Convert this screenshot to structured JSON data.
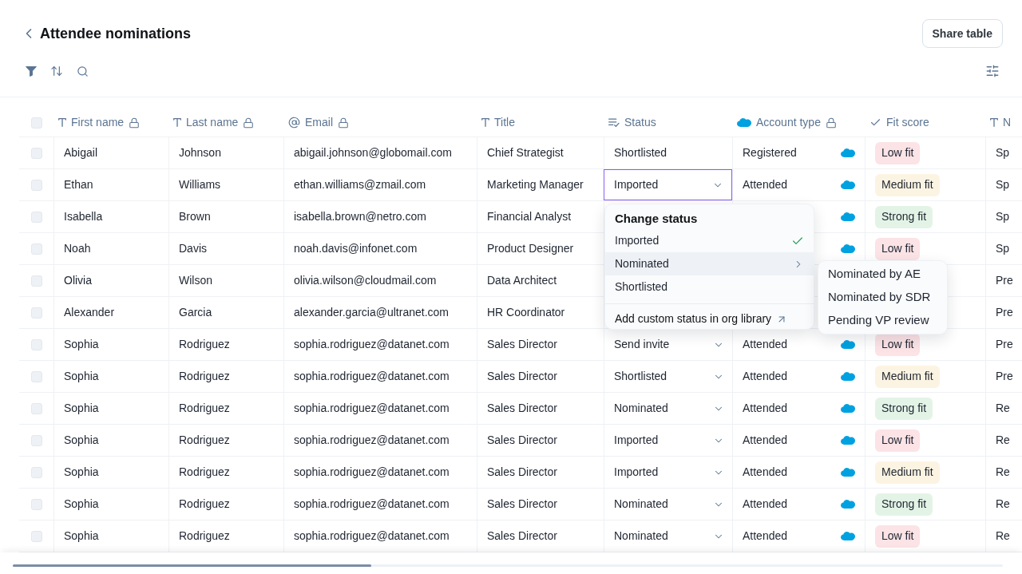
{
  "header": {
    "title": "Attendee nominations",
    "share_button": "Share table"
  },
  "table": {
    "select_all": {
      "checked": false
    },
    "columns": [
      {
        "label": "First name",
        "kind": "text",
        "locked": true
      },
      {
        "label": "Last name",
        "kind": "text",
        "locked": true
      },
      {
        "label": "Email",
        "kind": "email",
        "locked": true
      },
      {
        "label": "Title",
        "kind": "text",
        "locked": false
      },
      {
        "label": "Status",
        "kind": "status",
        "locked": false
      },
      {
        "label": "Account type",
        "kind": "synced",
        "locked": true
      },
      {
        "label": "Fit score",
        "kind": "score",
        "locked": false
      },
      {
        "label": "N",
        "kind": "text",
        "locked": false
      }
    ],
    "rows": [
      {
        "checked": false,
        "first_name": "Abigail",
        "last_name": "Johnson",
        "email": "abigail.johnson@globomail.com",
        "title": "Chief Strategist",
        "status": {
          "value": "Shortlisted",
          "has_dropdown": false,
          "focused": false
        },
        "account_type": {
          "value": "Registered",
          "synced": true
        },
        "fit_score": {
          "label": "Low fit",
          "color": "#fbe3e6"
        },
        "column_9": "Sp"
      },
      {
        "checked": false,
        "first_name": "Ethan",
        "last_name": "Williams",
        "email": "ethan.williams@zmail.com",
        "title": "Marketing Manager",
        "status": {
          "value": "Imported",
          "has_dropdown": true,
          "focused": true
        },
        "account_type": {
          "value": "Attended",
          "synced": true
        },
        "fit_score": {
          "label": "Medium fit",
          "color": "#fcf4e2"
        },
        "column_9": "Sp"
      },
      {
        "checked": false,
        "first_name": "Isabella",
        "last_name": "Brown",
        "email": "isabella.brown@netro.com",
        "title": "Financial Analyst",
        "account_type": {
          "synced": true
        },
        "fit_score": {
          "label": "Strong fit",
          "color": "#e3f4e7"
        },
        "column_9": "Sp"
      },
      {
        "checked": false,
        "first_name": "Noah",
        "last_name": "Davis",
        "email": "noah.davis@infonet.com",
        "title": "Product Designer",
        "account_type": {
          "synced": true
        },
        "fit_score": {
          "label": "Low fit",
          "color": "#fbe3e6"
        },
        "column_9": "Sp"
      },
      {
        "checked": false,
        "first_name": "Olivia",
        "last_name": "Wilson",
        "email": "olivia.wilson@cloudmail.com",
        "title": "Data Architect",
        "column_9": "Pre"
      },
      {
        "checked": false,
        "first_name": "Alexander",
        "last_name": "Garcia",
        "email": "alexander.garcia@ultranet.com",
        "title": "HR Coordinator",
        "column_9": "Pre"
      },
      {
        "checked": false,
        "first_name": "Sophia",
        "last_name": "Rodriguez",
        "email": "sophia.rodriguez@datanet.com",
        "title": "Sales Director",
        "status": {
          "value": "Send invite",
          "has_dropdown": true,
          "focused": false
        },
        "account_type": {
          "value": "Attended",
          "synced": true
        },
        "fit_score": {
          "label": "Low fit",
          "color": "#fbe3e6"
        },
        "column_9": "Pre"
      },
      {
        "checked": false,
        "first_name": "Sophia",
        "last_name": "Rodriguez",
        "email": "sophia.rodriguez@datanet.com",
        "title": "Sales Director",
        "status": {
          "value": "Shortlisted",
          "has_dropdown": true,
          "focused": false
        },
        "account_type": {
          "value": "Attended",
          "synced": true
        },
        "fit_score": {
          "label": "Medium fit",
          "color": "#fcf4e2"
        },
        "column_9": "Pre"
      },
      {
        "checked": false,
        "first_name": "Sophia",
        "last_name": "Rodriguez",
        "email": "sophia.rodriguez@datanet.com",
        "title": "Sales Director",
        "status": {
          "value": "Nominated",
          "has_dropdown": true,
          "focused": false
        },
        "account_type": {
          "value": "Attended",
          "synced": true
        },
        "fit_score": {
          "label": "Strong fit",
          "color": "#e3f4e7"
        },
        "column_9": "Re"
      },
      {
        "checked": false,
        "first_name": "Sophia",
        "last_name": "Rodriguez",
        "email": "sophia.rodriguez@datanet.com",
        "title": "Sales Director",
        "status": {
          "value": "Imported",
          "has_dropdown": true,
          "focused": false
        },
        "account_type": {
          "value": "Attended",
          "synced": true
        },
        "fit_score": {
          "label": "Low fit",
          "color": "#fbe3e6"
        },
        "column_9": "Re"
      },
      {
        "checked": false,
        "first_name": "Sophia",
        "last_name": "Rodriguez",
        "email": "sophia.rodriguez@datanet.com",
        "title": "Sales Director",
        "status": {
          "value": "Imported",
          "has_dropdown": true,
          "focused": false
        },
        "account_type": {
          "value": "Attended",
          "synced": true
        },
        "fit_score": {
          "label": "Medium fit",
          "color": "#fcf4e2"
        },
        "column_9": "Re"
      },
      {
        "checked": false,
        "first_name": "Sophia",
        "last_name": "Rodriguez",
        "email": "sophia.rodriguez@datanet.com",
        "title": "Sales Director",
        "status": {
          "value": "Nominated",
          "has_dropdown": true,
          "focused": false
        },
        "account_type": {
          "value": "Attended",
          "synced": true
        },
        "fit_score": {
          "label": "Strong fit",
          "color": "#e3f4e7"
        },
        "column_9": "Re"
      },
      {
        "checked": false,
        "first_name": "Sophia",
        "last_name": "Rodriguez",
        "email": "sophia.rodriguez@datanet.com",
        "title": "Sales Director",
        "status": {
          "value": "Nominated",
          "has_dropdown": true,
          "focused": false
        },
        "account_type": {
          "value": "Attended",
          "synced": true
        },
        "fit_score": {
          "label": "Low fit",
          "color": "#fbe3e6"
        },
        "column_9": "Re"
      }
    ]
  },
  "status_menu": {
    "title": "Change status",
    "options": [
      {
        "label": "Imported",
        "kind": "option",
        "selected": true,
        "highlighted": false
      },
      {
        "label": "Nominated",
        "kind": "submenu",
        "selected": false,
        "highlighted": true
      },
      {
        "label": "Shortlisted",
        "kind": "option",
        "selected": false,
        "highlighted": false
      }
    ],
    "footer_link": "Add custom status in org library",
    "submenu": [
      {
        "label": "Nominated by AE"
      },
      {
        "label": "Nominated by SDR"
      },
      {
        "label": "Pending VP review"
      }
    ]
  }
}
